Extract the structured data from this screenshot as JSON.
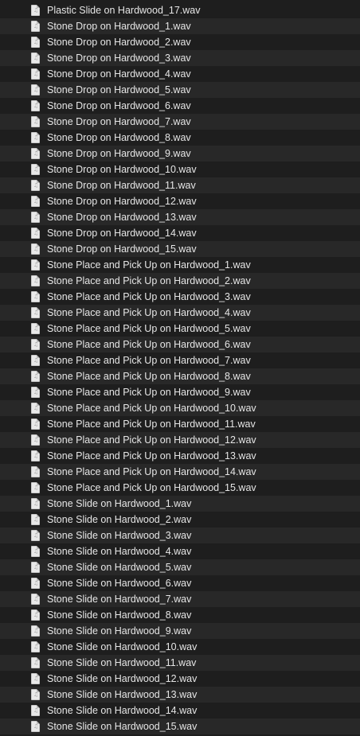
{
  "icons": {
    "file": "audio-file-icon",
    "glyph": "♫"
  },
  "files": [
    "Plastic Slide on Hardwood_17.wav",
    "Stone Drop on Hardwood_1.wav",
    "Stone Drop on Hardwood_2.wav",
    "Stone Drop on Hardwood_3.wav",
    "Stone Drop on Hardwood_4.wav",
    "Stone Drop on Hardwood_5.wav",
    "Stone Drop on Hardwood_6.wav",
    "Stone Drop on Hardwood_7.wav",
    "Stone Drop on Hardwood_8.wav",
    "Stone Drop on Hardwood_9.wav",
    "Stone Drop on Hardwood_10.wav",
    "Stone Drop on Hardwood_11.wav",
    "Stone Drop on Hardwood_12.wav",
    "Stone Drop on Hardwood_13.wav",
    "Stone Drop on Hardwood_14.wav",
    "Stone Drop on Hardwood_15.wav",
    "Stone Place and Pick Up on Hardwood_1.wav",
    "Stone Place and Pick Up on Hardwood_2.wav",
    "Stone Place and Pick Up on Hardwood_3.wav",
    "Stone Place and Pick Up on Hardwood_4.wav",
    "Stone Place and Pick Up on Hardwood_5.wav",
    "Stone Place and Pick Up on Hardwood_6.wav",
    "Stone Place and Pick Up on Hardwood_7.wav",
    "Stone Place and Pick Up on Hardwood_8.wav",
    "Stone Place and Pick Up on Hardwood_9.wav",
    "Stone Place and Pick Up on Hardwood_10.wav",
    "Stone Place and Pick Up on Hardwood_11.wav",
    "Stone Place and Pick Up on Hardwood_12.wav",
    "Stone Place and Pick Up on Hardwood_13.wav",
    "Stone Place and Pick Up on Hardwood_14.wav",
    "Stone Place and Pick Up on Hardwood_15.wav",
    "Stone Slide on Hardwood_1.wav",
    "Stone Slide on Hardwood_2.wav",
    "Stone Slide on Hardwood_3.wav",
    "Stone Slide on Hardwood_4.wav",
    "Stone Slide on Hardwood_5.wav",
    "Stone Slide on Hardwood_6.wav",
    "Stone Slide on Hardwood_7.wav",
    "Stone Slide on Hardwood_8.wav",
    "Stone Slide on Hardwood_9.wav",
    "Stone Slide on Hardwood_10.wav",
    "Stone Slide on Hardwood_11.wav",
    "Stone Slide on Hardwood_12.wav",
    "Stone Slide on Hardwood_13.wav",
    "Stone Slide on Hardwood_14.wav",
    "Stone Slide on Hardwood_15.wav"
  ]
}
